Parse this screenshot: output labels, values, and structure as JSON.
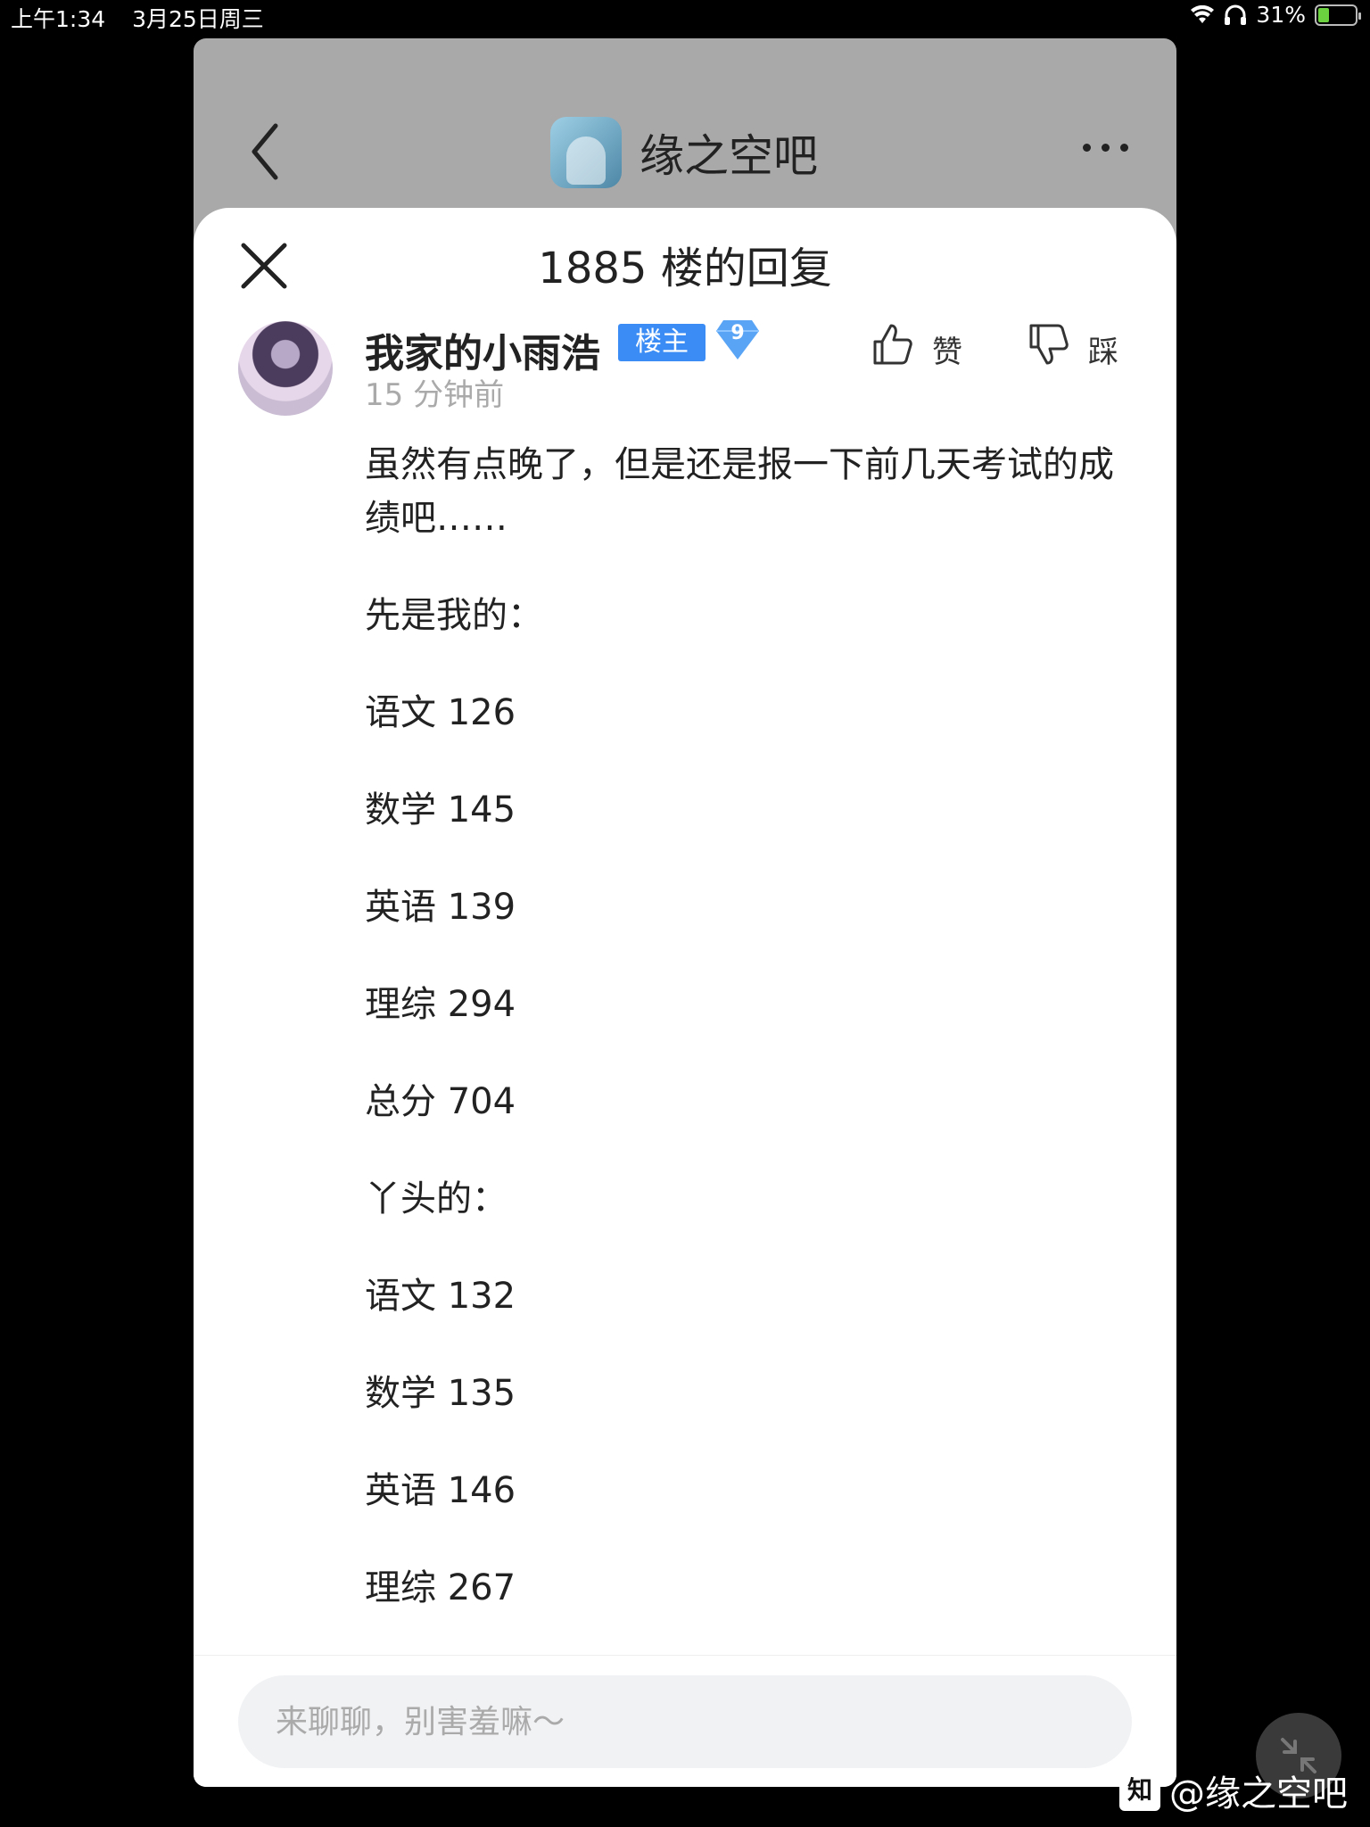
{
  "status_bar": {
    "time": "上午1:34",
    "date": "3月25日周三",
    "battery_percent": "31%",
    "battery_level": 0.31,
    "icons": [
      "wifi-icon",
      "headphone-icon",
      "battery-icon"
    ]
  },
  "nav": {
    "title": "缘之空吧",
    "icons": [
      "back-chevron-icon",
      "forum-avatar",
      "more-icon"
    ]
  },
  "sheet": {
    "title": "1885 楼的回复",
    "close_icon": "close-icon"
  },
  "post": {
    "username": "我家的小雨浩",
    "op_badge": "楼主",
    "level": "9",
    "time": "15 分钟前",
    "like_label": "赞",
    "dislike_label": "踩",
    "lines": [
      "虽然有点晚了，但是还是报一下前几天考试的成绩吧……",
      "先是我的：",
      "语文 126",
      "数学 145",
      "英语 139",
      "理综 294",
      "总分 704",
      "丫头的：",
      "语文 132",
      "数学 135",
      "英语 146",
      "理综 267"
    ]
  },
  "reply": {
    "placeholder": "来聊聊，别害羞嘛～"
  },
  "watermark": {
    "logo": "知",
    "text": "@缘之空吧"
  },
  "colors": {
    "accent": "#3b8df5",
    "overlay_bg": "#a9a9a9",
    "battery": "#6bd13f"
  }
}
